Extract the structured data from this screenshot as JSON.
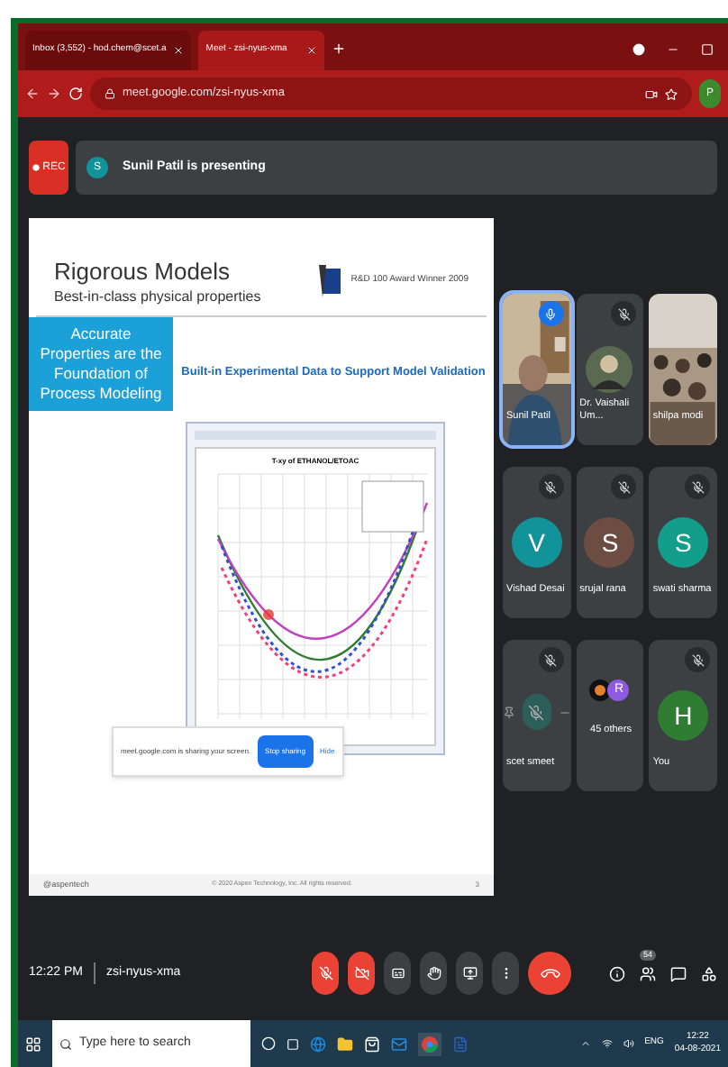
{
  "browser": {
    "tabs": [
      {
        "title": "Inbox (3,552) - hod.chem@scet.a",
        "selected": false
      },
      {
        "title": "Meet - zsi-nyus-xma",
        "selected": true
      }
    ],
    "url": "meet.google.com/zsi-nyus-xma",
    "profile": "P"
  },
  "meet": {
    "recording": "REC",
    "presenter_initial": "S",
    "presenting": "Sunil Patil is presenting"
  },
  "slide": {
    "title": "Rigorous Models",
    "subtitle": "Best-in-class physical properties",
    "award": "R&D 100 Award Winner 2009",
    "callout": "Accurate Properties are the Foundation of Process Modeling",
    "heading": "Built-in Experimental Data to Support Model Validation",
    "chart_title": "T-xy of ETHANOL/ETOAC",
    "share_notice": "meet.google.com is sharing your screen.",
    "stop_button": "Stop sharing",
    "hide_button": "Hide",
    "logo": "@aspentech",
    "footer": "© 2020 Aspen Technology, Inc. All rights reserved.",
    "page": "3"
  },
  "tiles": [
    {
      "kind": "video",
      "name": "Sunil Patil",
      "speaking": true,
      "muted": false
    },
    {
      "name": "Dr. Vaishali Um...",
      "speaking": false,
      "muted": true
    },
    {
      "kind": "video",
      "name": "shilpa modi",
      "speaking": false,
      "muted": false
    },
    {
      "kind": "avatar",
      "name": "Vishad Desai",
      "initial": "V",
      "color": "#12939a",
      "speaking": false,
      "muted": true
    },
    {
      "kind": "avatar",
      "name": "srujal rana",
      "initial": "S",
      "color": "#6d4c41",
      "speaking": false,
      "muted": true
    },
    {
      "kind": "avatar",
      "name": "swati sharma",
      "initial": "S",
      "color": "#129e8a",
      "speaking": false,
      "muted": true
    },
    {
      "kind": "hover",
      "name": "scet smeet",
      "speaking": false,
      "muted": true
    },
    {
      "kind": "others",
      "name": "45 others",
      "initial": "R",
      "speaking": false,
      "muted": false
    },
    {
      "kind": "avatar",
      "name": "You",
      "initial": "H",
      "color": "#2e7d32",
      "speaking": false,
      "muted": true
    }
  ],
  "bottom_bar": {
    "time": "12:22 PM",
    "code": "zsi-nyus-xma",
    "mic_on": false,
    "camera_on": false,
    "people_count": "54"
  },
  "taskbar": {
    "search_placeholder": "Type here to search",
    "language": "ENG",
    "time": "12:22",
    "date": "04-08-2021"
  }
}
